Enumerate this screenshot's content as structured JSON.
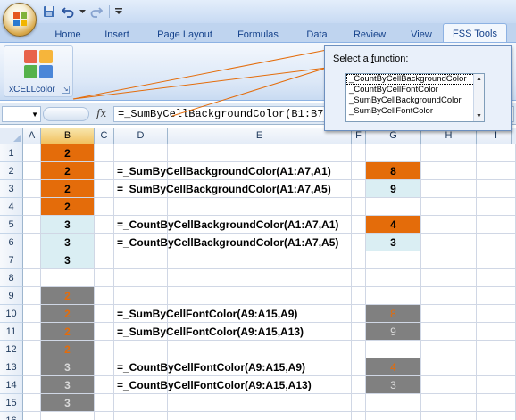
{
  "quick_access": {
    "icons": [
      "save-icon",
      "undo-icon",
      "undo-dropdown-icon",
      "redo-icon",
      "customize-qat-icon"
    ]
  },
  "tabs": [
    "Home",
    "Insert",
    "Page Layout",
    "Formulas",
    "Data",
    "Review",
    "View",
    "FSS Tools"
  ],
  "active_tab": "FSS Tools",
  "ribbon": {
    "group_label": "xCELLcolor",
    "button_icon": "color-grid-icon"
  },
  "formula_bar": {
    "name_box": "",
    "fx_label": "fx",
    "formula": "=_SumByCellBackgroundColor(B1:B7,"
  },
  "columns": [
    "A",
    "B",
    "C",
    "D",
    "E",
    "F",
    "G",
    "H",
    "I"
  ],
  "selected_column": "B",
  "rows": [
    "1",
    "2",
    "3",
    "4",
    "5",
    "6",
    "7",
    "8",
    "9",
    "10",
    "11",
    "12",
    "13",
    "14",
    "15",
    "16"
  ],
  "column_b": [
    "2",
    "2",
    "2",
    "2",
    "3",
    "3",
    "3",
    "",
    "2",
    "2",
    "2",
    "2",
    "3",
    "3",
    "3",
    ""
  ],
  "formulas": {
    "r2": "=_SumByCellBackgroundColor(A1:A7,A1)",
    "r3": "=_SumByCellBackgroundColor(A1:A7,A5)",
    "r5": "=_CountByCellBackgroundColor(A1:A7,A1)",
    "r6": "=_CountByCellBackgroundColor(A1:A7,A5)",
    "r10": "=_SumByCellFontColor(A9:A15,A9)",
    "r11": "=_SumByCellFontColor(A9:A15,A13)",
    "r13": "=_CountByCellFontColor(A9:A15,A9)",
    "r14": "=_CountByCellFontColor(A9:A15,A13)"
  },
  "results": {
    "r2": "8",
    "r3": "9",
    "r5": "4",
    "r6": "3",
    "r10": "8",
    "r11": "9",
    "r13": "4",
    "r14": "3"
  },
  "colors": {
    "orange": "#e46c0a",
    "lightblue": "#daeef3",
    "gray": "#808080",
    "font_orange": "#e46c0a",
    "font_light": "#d9d9d9"
  },
  "popup": {
    "title_prefix": "Select a ",
    "title_underlined": "f",
    "title_suffix": "unction:",
    "functions": [
      "_CountByCellBackgroundColor",
      "_CountByCellFontColor",
      "_SumByCellBackgroundColor",
      "_SumByCellFontColor"
    ],
    "selected_index": 0
  }
}
